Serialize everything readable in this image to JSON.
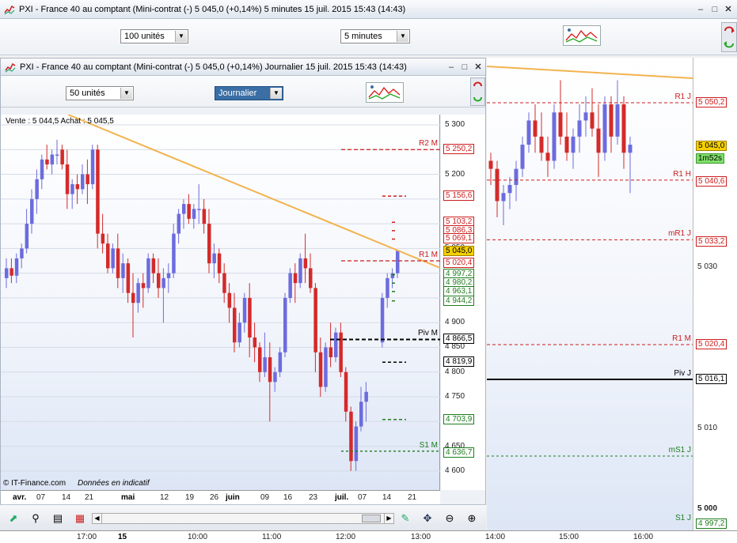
{
  "outer": {
    "title": "PXI - France 40 au comptant (Mini-contrat  (-)    5 045,0 (+0,14%)    5 minutes  15 juil. 2015 15:43 (14:43)",
    "units_combo": "100 unités",
    "period_combo": "5 minutes"
  },
  "inner": {
    "title": "PXI - France 40 au comptant (Mini-contrat  (-)    5 045,0 (+0,14%)    Journalier  15 juil. 2015 15:43 (14:43)",
    "units_combo": "50 unités",
    "period_combo": "Journalier",
    "quote": "Vente : 5 044,5 Achat : 5 045,5",
    "copyright": "© IT-Finance.com",
    "disclaimer": "Données en indicatif"
  },
  "colors": {
    "up": "#6c6cde",
    "down": "#d42a2a",
    "trend": "#f2b34e",
    "resist": "#cc1d1d",
    "support": "#1e7d1e",
    "pivot": "#000000"
  },
  "daily_axis": {
    "ticks": [
      "5 300",
      "5 250",
      "5 200",
      "5 150",
      "5 100",
      "5 050",
      "5 000",
      "4 950",
      "4 900",
      "4 850",
      "4 800",
      "4 750",
      "4 700",
      "4 650",
      "4 600"
    ],
    "tags": [
      {
        "label": "5 250,2",
        "kind": "resist"
      },
      {
        "label": "5 156,6",
        "kind": "resist"
      },
      {
        "label": "5 103,2",
        "kind": "resist"
      },
      {
        "label": "5 086,3",
        "kind": "resist"
      },
      {
        "label": "5 069,1",
        "kind": "resist"
      },
      {
        "label": "5 045,0",
        "kind": "current"
      },
      {
        "label": "5 020,4",
        "kind": "resist"
      },
      {
        "label": "4 997,2",
        "kind": "support"
      },
      {
        "label": "4 980,2",
        "kind": "support"
      },
      {
        "label": "4 963,1",
        "kind": "support"
      },
      {
        "label": "4 944,2",
        "kind": "support"
      },
      {
        "label": "4 866,5",
        "kind": "pivot"
      },
      {
        "label": "4 819,9",
        "kind": "pivot"
      },
      {
        "label": "4 703,9",
        "kind": "support"
      },
      {
        "label": "4 636,7",
        "kind": "support"
      }
    ],
    "levels": [
      {
        "label": "R2 M",
        "kind": "resist"
      },
      {
        "label": "R1 M",
        "kind": "resist"
      },
      {
        "label": "Piv M",
        "kind": "pivot"
      },
      {
        "label": "S1 M",
        "kind": "support"
      }
    ]
  },
  "daily_dates": [
    {
      "label": "avr.",
      "bold": true
    },
    {
      "label": "07",
      "bold": false
    },
    {
      "label": "14",
      "bold": false
    },
    {
      "label": "21",
      "bold": false
    },
    {
      "label": "mai",
      "bold": true
    },
    {
      "label": "12",
      "bold": false
    },
    {
      "label": "19",
      "bold": false
    },
    {
      "label": "26",
      "bold": false
    },
    {
      "label": "juin",
      "bold": true
    },
    {
      "label": "09",
      "bold": false
    },
    {
      "label": "16",
      "bold": false
    },
    {
      "label": "23",
      "bold": false
    },
    {
      "label": "juil.",
      "bold": true
    },
    {
      "label": "07",
      "bold": false
    },
    {
      "label": "14",
      "bold": false
    },
    {
      "label": "21",
      "bold": false
    }
  ],
  "intraday_axis": {
    "ticks": [
      "5 030",
      "5 010",
      "5 000"
    ],
    "tags": [
      {
        "label": "5 050,2",
        "kind": "resist"
      },
      {
        "label": "5 045,0",
        "kind": "current"
      },
      {
        "label": "1m52s",
        "kind": "timer"
      },
      {
        "label": "5 040,6",
        "kind": "resist"
      },
      {
        "label": "5 033,2",
        "kind": "resist"
      },
      {
        "label": "5 020,4",
        "kind": "resist"
      },
      {
        "label": "5 016,1",
        "kind": "pivot"
      },
      {
        "label": "4 997,2",
        "kind": "support"
      }
    ],
    "levels": [
      {
        "label": "R1 J",
        "kind": "resist"
      },
      {
        "label": "R1 H",
        "kind": "resist"
      },
      {
        "label": "mR1 J",
        "kind": "resist"
      },
      {
        "label": "R1 M",
        "kind": "resist"
      },
      {
        "label": "Piv J",
        "kind": "pivot"
      },
      {
        "label": "mS1 J",
        "kind": "support"
      },
      {
        "label": "S1 J",
        "kind": "support"
      }
    ]
  },
  "times": [
    {
      "label": "17:00",
      "bold": false
    },
    {
      "label": "15",
      "bold": true
    },
    {
      "label": "10:00",
      "bold": false
    },
    {
      "label": "11:00",
      "bold": false
    },
    {
      "label": "12:00",
      "bold": false
    },
    {
      "label": "13:00",
      "bold": false
    },
    {
      "label": "14:00",
      "bold": false
    },
    {
      "label": "15:00",
      "bold": false
    },
    {
      "label": "16:00",
      "bold": false
    }
  ],
  "chart_data": {
    "type": "candlestick",
    "title": "PXI - France 40 au comptant (Mini-contrat",
    "daily_candles": [
      [
        4990,
        5030,
        4970,
        5010
      ],
      [
        5010,
        5030,
        4980,
        4995
      ],
      [
        4995,
        5040,
        4980,
        5030
      ],
      [
        5030,
        5060,
        5010,
        5050
      ],
      [
        5050,
        5130,
        5040,
        5100
      ],
      [
        5100,
        5170,
        5080,
        5150
      ],
      [
        5150,
        5210,
        5120,
        5190
      ],
      [
        5190,
        5240,
        5170,
        5230
      ],
      [
        5230,
        5260,
        5210,
        5220
      ],
      [
        5220,
        5250,
        5200,
        5240
      ],
      [
        5240,
        5270,
        5220,
        5240
      ],
      [
        5250,
        5260,
        5210,
        5220
      ],
      [
        5220,
        5250,
        5130,
        5160
      ],
      [
        5160,
        5190,
        5130,
        5180
      ],
      [
        5180,
        5200,
        5140,
        5170
      ],
      [
        5170,
        5220,
        5160,
        5200
      ],
      [
        5200,
        5230,
        5140,
        5180
      ],
      [
        5180,
        5260,
        5170,
        5250
      ],
      [
        5250,
        5260,
        5050,
        5080
      ],
      [
        5080,
        5120,
        5040,
        5060
      ],
      [
        5060,
        5080,
        5000,
        5010
      ],
      [
        5010,
        5060,
        5000,
        5050
      ],
      [
        5050,
        5080,
        4970,
        4990
      ],
      [
        4990,
        5040,
        4960,
        5020
      ],
      [
        5020,
        5030,
        4940,
        4960
      ],
      [
        4960,
        5000,
        4870,
        4940
      ],
      [
        4940,
        4990,
        4920,
        4980
      ],
      [
        4980,
        5000,
        4930,
        4970
      ],
      [
        4970,
        5040,
        4960,
        5030
      ],
      [
        5030,
        5040,
        4980,
        5000
      ],
      [
        5000,
        5030,
        4950,
        4970
      ],
      [
        4970,
        5010,
        4900,
        4990
      ],
      [
        4990,
        5020,
        4960,
        5000
      ],
      [
        5000,
        5100,
        4990,
        5080
      ],
      [
        5080,
        5130,
        5060,
        5120
      ],
      [
        5120,
        5150,
        5090,
        5140
      ],
      [
        5140,
        5160,
        5100,
        5110
      ],
      [
        5110,
        5140,
        5090,
        5130
      ],
      [
        5130,
        5180,
        5100,
        5130
      ],
      [
        5130,
        5150,
        5080,
        5100
      ],
      [
        5100,
        5130,
        5000,
        5020
      ],
      [
        5020,
        5060,
        4990,
        5040
      ],
      [
        5040,
        5050,
        4980,
        5000
      ],
      [
        5000,
        5020,
        4940,
        4960
      ],
      [
        4960,
        4980,
        4900,
        4930
      ],
      [
        4930,
        4960,
        4840,
        4860
      ],
      [
        4860,
        4920,
        4850,
        4900
      ],
      [
        4900,
        4960,
        4880,
        4950
      ],
      [
        4950,
        4980,
        4830,
        4870
      ],
      [
        4870,
        4900,
        4820,
        4850
      ],
      [
        4850,
        4860,
        4780,
        4800
      ],
      [
        4800,
        4880,
        4790,
        4830
      ],
      [
        4830,
        4860,
        4700,
        4780
      ],
      [
        4780,
        4810,
        4760,
        4800
      ],
      [
        4800,
        4850,
        4790,
        4840
      ],
      [
        4840,
        4960,
        4830,
        4950
      ],
      [
        4950,
        5010,
        4940,
        5000
      ],
      [
        5000,
        5020,
        4940,
        4980
      ],
      [
        4980,
        5040,
        4970,
        5030
      ],
      [
        5030,
        5080,
        4980,
        5010
      ],
      [
        5010,
        5040,
        4960,
        4970
      ],
      [
        4970,
        4980,
        4800,
        4840
      ],
      [
        4840,
        4870,
        4750,
        4770
      ],
      [
        4770,
        4860,
        4760,
        4850
      ],
      [
        4850,
        4900,
        4810,
        4830
      ],
      [
        4830,
        4890,
        4820,
        4880
      ],
      [
        4880,
        4900,
        4790,
        4800
      ],
      [
        4800,
        4810,
        4700,
        4720
      ],
      [
        4720,
        4730,
        4600,
        4620
      ],
      [
        4620,
        4700,
        4600,
        4690
      ],
      [
        4690,
        4770,
        4680,
        4740
      ],
      [
        4740,
        4780,
        4700,
        4760
      ],
      [
        4860,
        4960,
        4850,
        4950
      ],
      [
        4950,
        5000,
        4930,
        4990
      ],
      [
        4990,
        5010,
        4970,
        5000
      ],
      [
        5000,
        5045,
        4990,
        5045
      ]
    ],
    "intraday_candles": [
      [
        5043,
        5044,
        5040,
        5042
      ],
      [
        5042,
        5043,
        5036,
        5038
      ],
      [
        5038,
        5040,
        5035,
        5039
      ],
      [
        5039,
        5041,
        5037,
        5040
      ],
      [
        5040,
        5043,
        5038,
        5042
      ],
      [
        5042,
        5046,
        5041,
        5045
      ],
      [
        5045,
        5049,
        5044,
        5048
      ],
      [
        5048,
        5050,
        5044,
        5046
      ],
      [
        5046,
        5049,
        5043,
        5044
      ],
      [
        5044,
        5046,
        5041,
        5043
      ],
      [
        5043,
        5050,
        5042,
        5049
      ],
      [
        5049,
        5053,
        5045,
        5046
      ],
      [
        5046,
        5049,
        5043,
        5044
      ],
      [
        5044,
        5047,
        5042,
        5046
      ],
      [
        5046,
        5050,
        5044,
        5048
      ],
      [
        5048,
        5051,
        5046,
        5049
      ],
      [
        5049,
        5052,
        5046,
        5047
      ],
      [
        5047,
        5050,
        5041,
        5044
      ],
      [
        5044,
        5051,
        5043,
        5050
      ],
      [
        5050,
        5051,
        5044,
        5046
      ],
      [
        5046,
        5053,
        5045,
        5050
      ],
      [
        5050,
        5051,
        5042,
        5044
      ],
      [
        5044,
        5046,
        5039,
        5045
      ]
    ]
  }
}
